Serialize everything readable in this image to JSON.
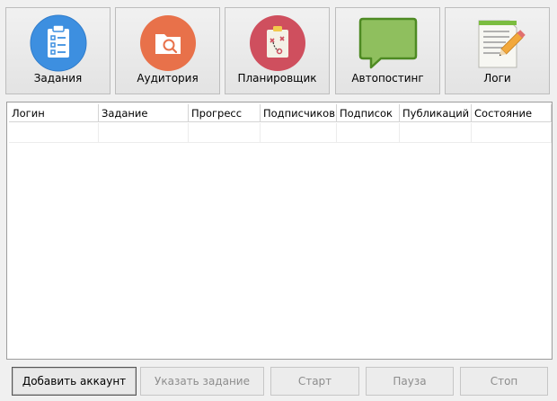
{
  "toolbar": {
    "buttons": [
      {
        "label": "Задания",
        "icon": "tasks-clipboard-icon"
      },
      {
        "label": "Аудитория",
        "icon": "audience-folder-search-icon"
      },
      {
        "label": "Планировщик",
        "icon": "planner-clipboard-icon"
      },
      {
        "label": "Автопостинг",
        "icon": "autoposting-speech-bubble-icon"
      },
      {
        "label": "Логи",
        "icon": "logs-notepad-pencil-icon"
      }
    ]
  },
  "grid": {
    "columns": [
      "Логин",
      "Задание",
      "Прогресс",
      "Подписчиков",
      "Подписок",
      "Публикаций",
      "Состояние"
    ],
    "rows": [
      [
        "",
        "",
        "",
        "",
        "",
        "",
        ""
      ]
    ]
  },
  "actions": {
    "add_account": "Добавить аккаунт",
    "set_task": "Указать задание",
    "start": "Старт",
    "pause": "Пауза",
    "stop": "Стоп"
  },
  "colors": {
    "tasks_icon": "#3d8fe0",
    "audience_icon": "#e8714a",
    "planner_icon": "#cf4f5e",
    "autoposting_icon": "#8fbf5e"
  }
}
